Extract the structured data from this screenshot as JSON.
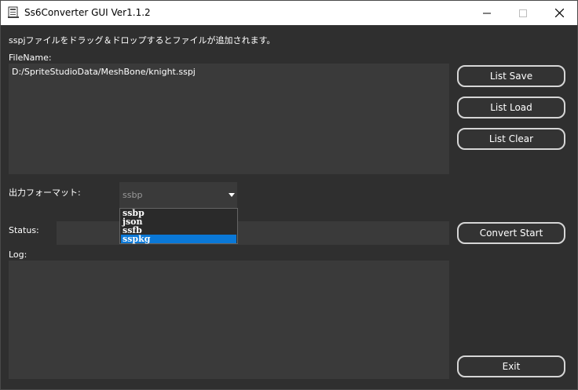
{
  "window": {
    "title": "Ss6Converter GUI Ver1.1.2",
    "min_icon": "minimize-icon",
    "max_icon": "maximize-icon",
    "close_icon": "close-icon"
  },
  "instructions": "sspjファイルをドラッグ＆ドロップするとファイルが追加されます。",
  "filename": {
    "label": "FileName:",
    "items": [
      "D:/SpriteStudioData/MeshBone/knight.sspj"
    ]
  },
  "buttons": {
    "list_save": "List Save",
    "list_load": "List Load",
    "list_clear": "List Clear",
    "convert_start": "Convert Start",
    "exit": "Exit"
  },
  "format": {
    "label": "出力フォーマット:",
    "selected": "ssbp",
    "options": [
      "ssbp",
      "json",
      "ssfb",
      "sspkg"
    ],
    "highlighted": "sspkg"
  },
  "status": {
    "label": "Status:",
    "value": ""
  },
  "log": {
    "label": "Log:",
    "value": ""
  },
  "colors": {
    "background": "#2f2f2f",
    "panel": "#3a3a3a",
    "highlight": "#0a78d7",
    "button_border": "#d6d6d6"
  }
}
